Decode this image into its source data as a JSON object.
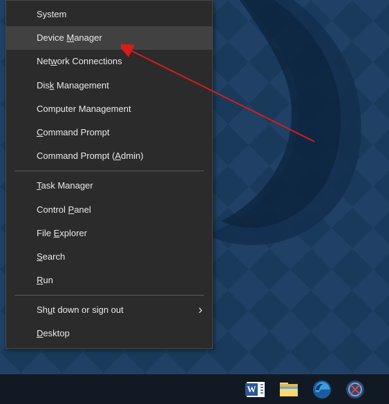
{
  "menu": {
    "groups": [
      [
        {
          "label": "System",
          "underline": null,
          "hasSubmenu": false,
          "highlighted": false
        },
        {
          "label": "Device Manager",
          "underline": "M",
          "hasSubmenu": false,
          "highlighted": true
        },
        {
          "label": "Network Connections",
          "underline": "w",
          "hasSubmenu": false,
          "highlighted": false
        },
        {
          "label": "Disk Management",
          "underline": "k",
          "hasSubmenu": false,
          "highlighted": false
        },
        {
          "label": "Computer Management",
          "underline": null,
          "hasSubmenu": false,
          "highlighted": false
        },
        {
          "label": "Command Prompt",
          "underline": "C",
          "hasSubmenu": false,
          "highlighted": false
        },
        {
          "label": "Command Prompt (Admin)",
          "underline": "A",
          "hasSubmenu": false,
          "highlighted": false
        }
      ],
      [
        {
          "label": "Task Manager",
          "underline": "T",
          "hasSubmenu": false,
          "highlighted": false
        },
        {
          "label": "Control Panel",
          "underline": "P",
          "hasSubmenu": false,
          "highlighted": false
        },
        {
          "label": "File Explorer",
          "underline": "E",
          "hasSubmenu": false,
          "highlighted": false
        },
        {
          "label": "Search",
          "underline": "S",
          "hasSubmenu": false,
          "highlighted": false
        },
        {
          "label": "Run",
          "underline": "R",
          "hasSubmenu": false,
          "highlighted": false
        }
      ],
      [
        {
          "label": "Shut down or sign out",
          "underline": "u",
          "hasSubmenu": true,
          "highlighted": false
        },
        {
          "label": "Desktop",
          "underline": "D",
          "hasSubmenu": false,
          "highlighted": false
        }
      ]
    ]
  },
  "taskbar": {
    "icons": [
      {
        "name": "word-icon",
        "letter": "W",
        "bg": "#2b579a"
      },
      {
        "name": "file-explorer-icon",
        "letter": "",
        "bg": "#ffcf48"
      },
      {
        "name": "edge-icon",
        "letter": "e",
        "bg": "#0a66b7"
      },
      {
        "name": "snip-icon",
        "letter": "",
        "bg": "#4a6a9a"
      }
    ]
  },
  "annotation": {
    "color": "#d91b1b"
  }
}
